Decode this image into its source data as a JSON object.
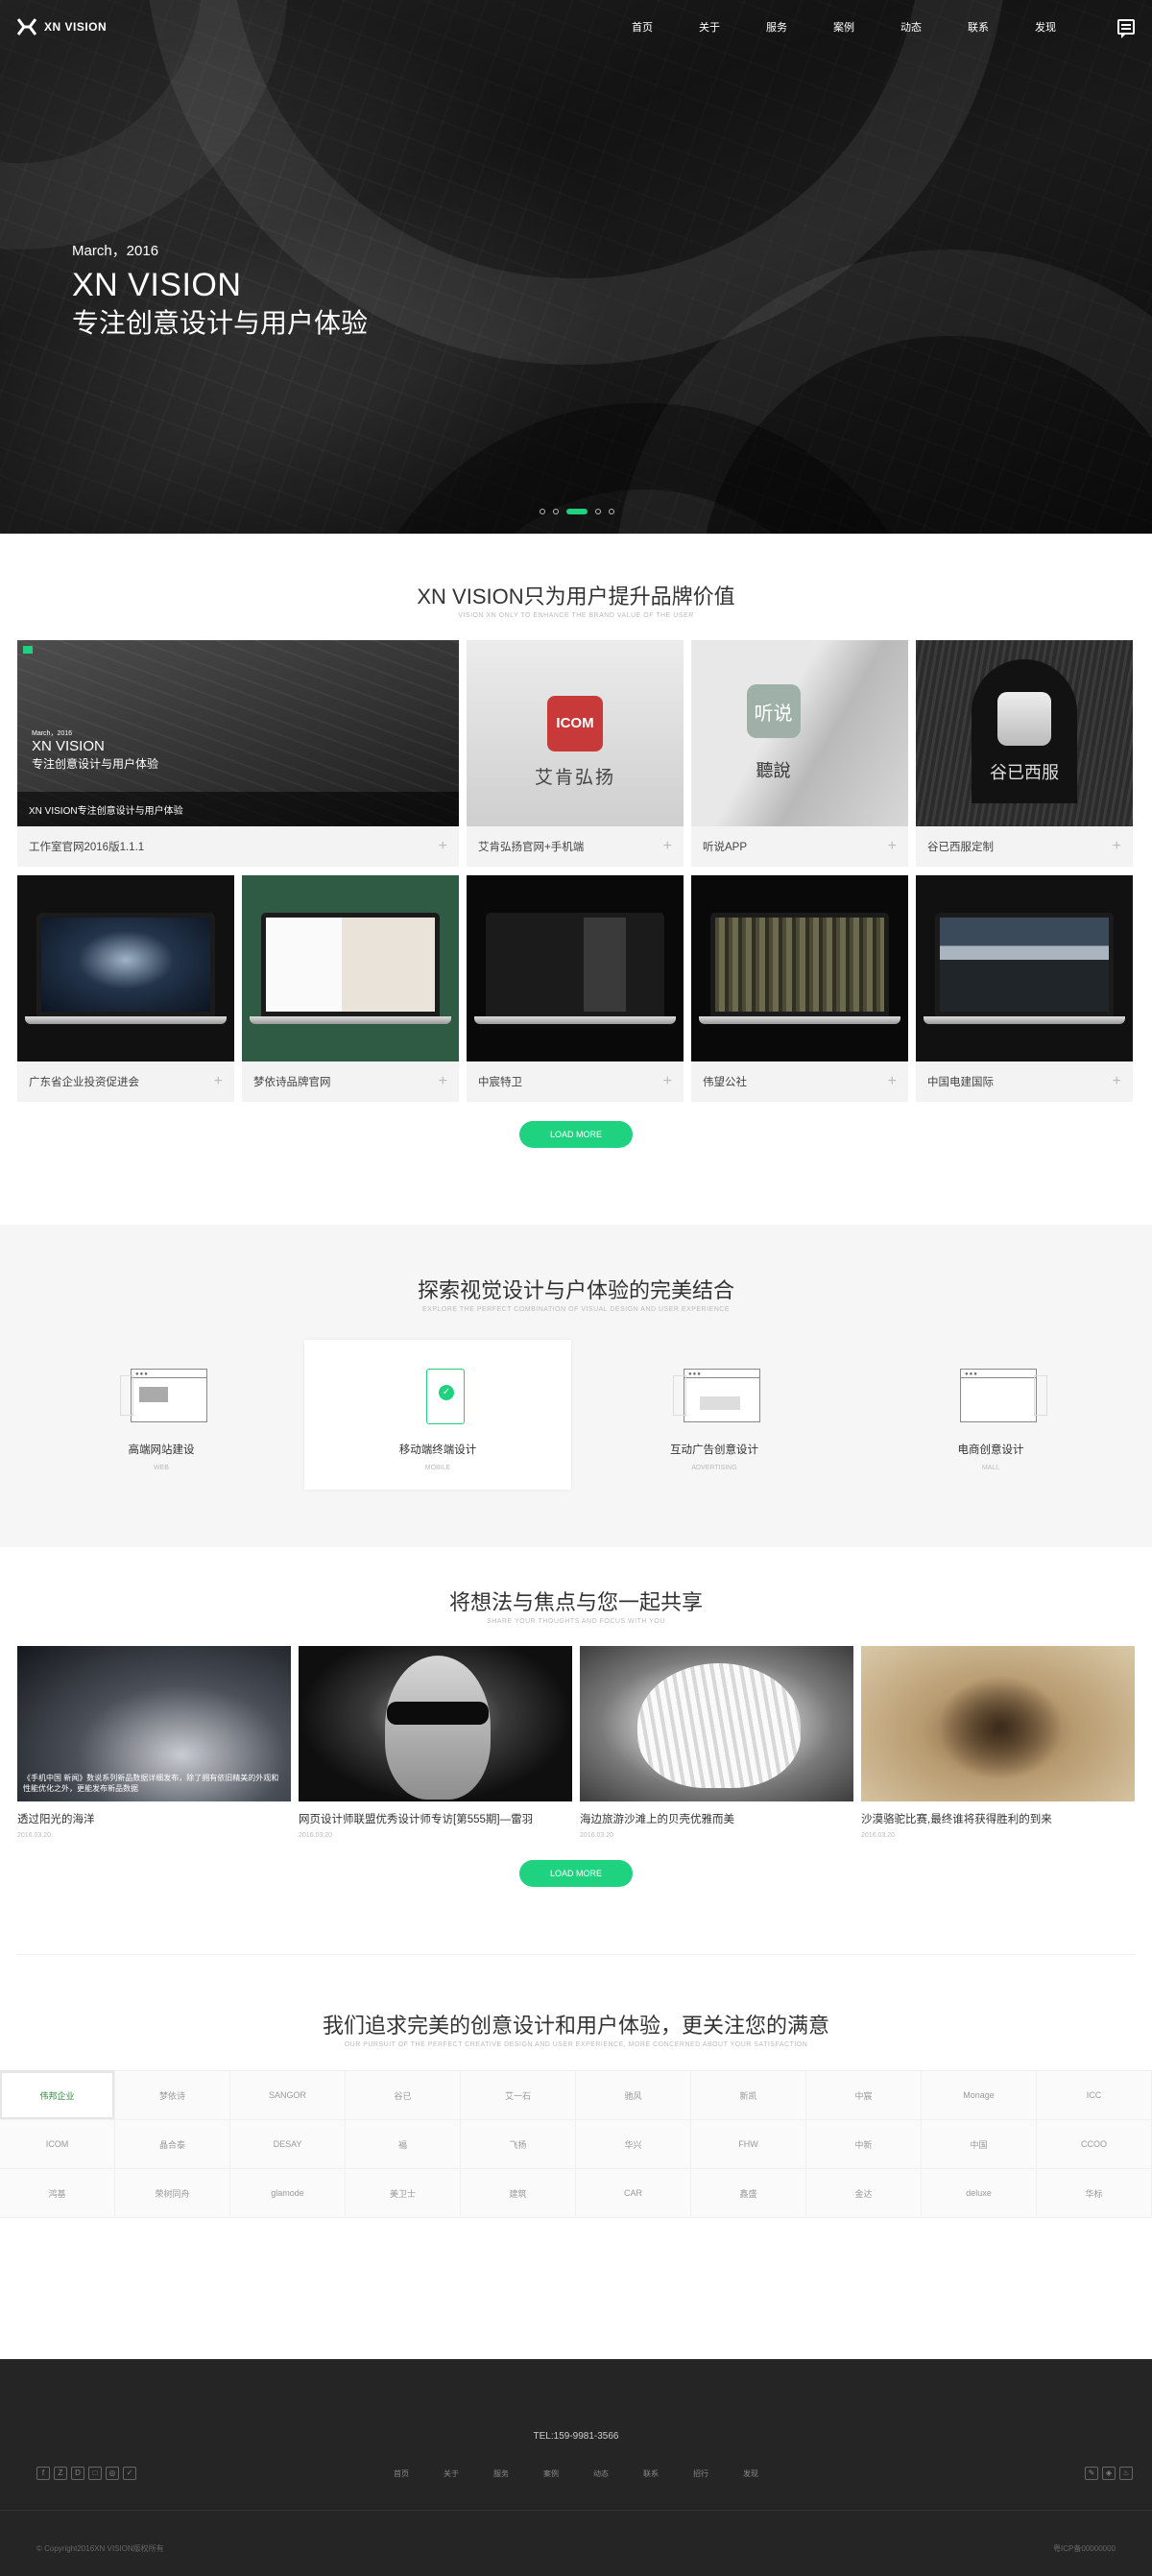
{
  "brand": {
    "name": "XN VISION"
  },
  "nav": {
    "items": [
      "首页",
      "关于",
      "服务",
      "案例",
      "动态",
      "联系",
      "发现"
    ]
  },
  "hero": {
    "date": "March，2016",
    "title": "XN VISION",
    "subtitle": "专注创意设计与用户体验",
    "active_slide": 3
  },
  "cases": {
    "title": "XN  VISION只为用户提升品牌价值",
    "subtitle": "VISION XN ONLY TO ENHANCE THE BRAND VALUE OF THE USER",
    "row1": [
      {
        "caption": "工作室官网2016版1.1.1",
        "mini_date": "March，2016",
        "mini_title": "XN VISION",
        "mini_sub": "专注创意设计与用户体验",
        "mini_bar": "XN VISION专注创意设计与用户体验"
      },
      {
        "caption": "艾肯弘扬官网+手机端",
        "badge": "ICOM",
        "name": "艾肯弘扬"
      },
      {
        "caption": "听说APP",
        "badge": "听说",
        "name": "聽說"
      },
      {
        "caption": "谷已西服定制",
        "name": "谷已西服"
      }
    ],
    "row2": [
      {
        "caption": "广东省企业投资促进会"
      },
      {
        "caption": "梦依诗品牌官网"
      },
      {
        "caption": "中宸特卫"
      },
      {
        "caption": "伟望公社"
      },
      {
        "caption": "中国电建国际"
      }
    ],
    "plus": "+",
    "load_more": "LOAD MORE"
  },
  "services": {
    "title": "探索视觉设计与户体验的完美结合",
    "subtitle": "EXPLORE THE PERFECT COMBINATION OF VISUAL DESIGN AND USER EXPERIENCE",
    "items": [
      {
        "name": "高端网站建设",
        "en": "WEB"
      },
      {
        "name": "移动端终端设计",
        "en": "MOBILE"
      },
      {
        "name": "互动广告创意设计",
        "en": "ADVERTISING"
      },
      {
        "name": "电商创意设计",
        "en": "Mall"
      }
    ]
  },
  "news": {
    "title": "将想法与焦点与您一起共享",
    "subtitle": "SHARE YOUR THOUGHTS AND FOCUS WITH YOU",
    "overlay": "《手机中国 新闻》数说系列新品数据详细发布，除了拥有依旧精美的外观和性能优化之外，更能发布新品数据",
    "items": [
      {
        "title": "透过阳光的海洋",
        "date": "2016.03.20"
      },
      {
        "title": "网页设计师联盟优秀设计师专访[第555期]—雷羽",
        "date": "2016.03.20"
      },
      {
        "title": "海边旅游沙滩上的贝壳优雅而美",
        "date": "2016.03.20"
      },
      {
        "title": "沙漠骆驼比赛,最终谁将获得胜利的到来",
        "date": "2016.03.20"
      }
    ],
    "load_more": "LOAD MORE"
  },
  "clients": {
    "title": "我们追求完美的创意设计和用户体验，更关注您的满意",
    "subtitle": "OUR PURSUIT OF THE PERFECT CREATIVE DESIGN AND USER EXPERIENCE, MORE CONCERNED ABOUT YOUR SATISFACTION",
    "logos": [
      "伟邦企业",
      "梦依诗",
      "SANGOR",
      "谷已",
      "艾一石",
      "驰风",
      "新凯",
      "中宸",
      "Monage",
      "ICC",
      "ICOM",
      "晶合泰",
      "DESAY",
      "福",
      "飞扬",
      "华兴",
      "FHW",
      "中新",
      "中国",
      "CCOO",
      "鸿基",
      "荣树同舟",
      "glamode",
      "美卫士",
      "建筑",
      "CAR",
      "鑫盛",
      "金达",
      "deluxe",
      "华标"
    ]
  },
  "footer": {
    "tel": "TEL:159-9981-3566",
    "nav": [
      "首页",
      "关于",
      "服务",
      "案例",
      "动态",
      "联系",
      "招行",
      "发现"
    ],
    "copyright": "© Copyright2016XN VISION版权所有",
    "icp": "粤ICP备00000000",
    "social_left": [
      "f",
      "Z",
      "D",
      "□",
      "◎",
      "✓"
    ],
    "social_right": [
      "✎",
      "◈",
      "♨"
    ]
  },
  "colors": {
    "accent": "#1ed27f",
    "footer_bg": "#252525",
    "service_bg": "#f6f6f6"
  }
}
